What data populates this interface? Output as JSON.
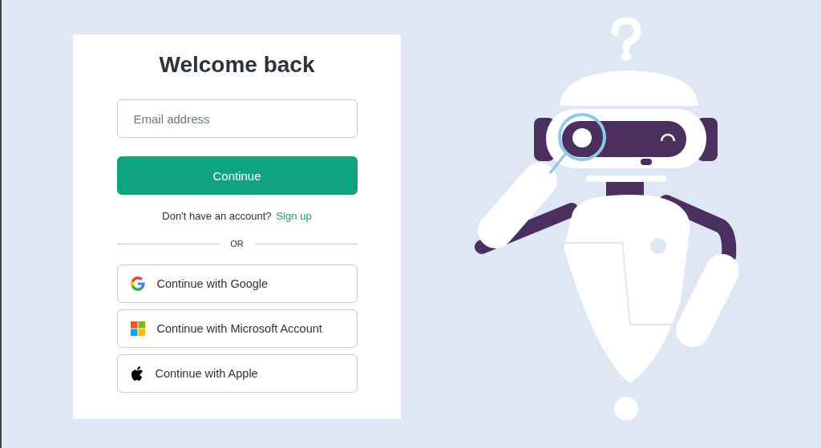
{
  "login_card": {
    "title": "Welcome back",
    "email_field": {
      "placeholder": "Email address"
    },
    "continue_button": "Continue",
    "signup_prompt": "Don't have an account?",
    "signup_link": "Sign up",
    "divider_text": "OR",
    "providers": [
      {
        "kind": "google",
        "label": "Continue with Google"
      },
      {
        "kind": "microsoft",
        "label": "Continue with Microsoft Account"
      },
      {
        "kind": "apple",
        "label": "Continue with Apple"
      }
    ]
  }
}
